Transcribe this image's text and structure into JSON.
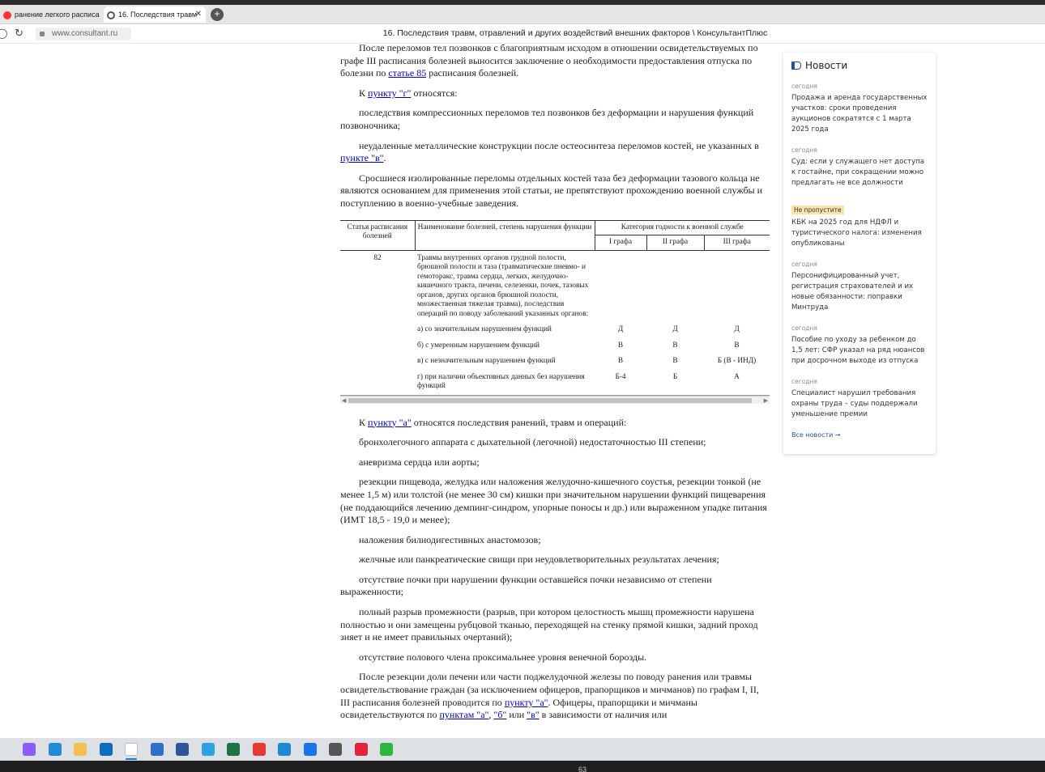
{
  "browser": {
    "tabs": [
      {
        "label": "ранение легкого расписа"
      },
      {
        "label": "16. Последствия травм"
      }
    ],
    "new_tab": "+",
    "url": "www.consultant.ru",
    "page_title": "16. Последствия травм, отравлений и других воздействий внешних факторов \\ КонсультантПлюс"
  },
  "doc": {
    "p0": "После переломов тел позвонков с благоприятным исходом в отношении освидетельствуемых по графе III расписания болезней выносится заключение о необходимости предоставления отпуска по болезни по ",
    "p0_link": "статье 85",
    "p0_tail": " расписания болезней.",
    "p1_pre": "К ",
    "p1_link": "пункту \"г\"",
    "p1_tail": " относятся:",
    "p2": "последствия компрессионных переломов тел позвонков без деформации и нарушения функций позвоночника;",
    "p3_pre": "неудаленные металлические конструкции после остеосинтеза переломов костей, не указанных в ",
    "p3_link": "пункте \"в\"",
    "p3_tail": ".",
    "p4": "Сросшиеся изолированные переломы отдельных костей таза без деформации тазового кольца не являются основанием для применения этой статьи, не препятствуют прохождению военной службы и поступлению в военно-учебные заведения.",
    "table": {
      "h_article": "Статья расписания болезней",
      "h_name": "Наименование болезней, степень нарушения функции",
      "h_category": "Категория годности к военной службе",
      "h_g1": "I графа",
      "h_g2": "II графа",
      "h_g3": "III графа",
      "article": "82",
      "desc": "Травмы внутренних органов грудной полости, брюшной полости и таза (травматические пневмо- и гемоторакс, травма сердца, легких, желудочно-кишечного тракта, печени, селезенки, почек, тазовых органов, других органов брюшной полости, множественная тяжелая травма), последствия операций по поводу заболеваний указанных органов:",
      "rows": [
        {
          "label": "а) со значительным нарушением функций",
          "g1": "Д",
          "g2": "Д",
          "g3": "Д"
        },
        {
          "label": "б) с умеренным нарушением функций",
          "g1": "В",
          "g2": "В",
          "g3": "В"
        },
        {
          "label": "в) с незначительным нарушением функций",
          "g1": "В",
          "g2": "В",
          "g3": "Б (В - ИНД)"
        },
        {
          "label": "г) при наличии объективных данных без нарушения функций",
          "g1": "Б-4",
          "g2": "Б",
          "g3": "А"
        }
      ]
    },
    "p5_pre": "К ",
    "p5_link": "пункту \"а\"",
    "p5_tail": " относятся последствия ранений, травм и операций:",
    "p6": "бронхолегочного аппарата с дыхательной (легочной) недостаточностью III степени;",
    "p7": "аневризма сердца или аорты;",
    "p8": "резекции пищевода, желудка или наложения желудочно-кишечного соустья, резекции тонкой (не менее 1,5 м) или толстой (не менее 30 см) кишки при значительном нарушении функций пищеварения (не поддающийся лечению демпинг-синдром, упорные поносы и др.) или выраженном упадке питания (ИМТ 18,5 - 19,0 и менее);",
    "p9": "наложения билиодигестивных анастомозов;",
    "p10": "желчные или панкреатические свищи при неудовлетворительных результатах лечения;",
    "p11": "отсутствие почки при нарушении функции оставшейся почки независимо от степени выраженности;",
    "p12": "полный разрыв промежности (разрыв, при котором целостность мышц промежности нарушена полностью и они замещены рубцовой тканью, переходящей на стенку прямой кишки, задний проход зияет и не имеет правильных очертаний);",
    "p13": "отсутствие полового члена проксимальнее уровня венечной борозды.",
    "p14_a": "После резекции доли печени или части поджелудочной железы по поводу ранения или травмы освидетельствование граждан (за исключением офицеров, прапорщиков и мичманов) по графам I, II, III расписания болезней проводится по ",
    "p14_link1": "пункту \"а\"",
    "p14_b": ". Офицеры, прапорщики и мичманы освидетельствуются по ",
    "p14_link2": "пунктам \"а\"",
    "p14_c": ", ",
    "p14_link3": "\"б\"",
    "p14_d": " или ",
    "p14_link4": "\"в\"",
    "p14_e": " в зависимости от наличия или"
  },
  "news": {
    "title": "Новости",
    "items": [
      {
        "date": "сегодня",
        "text": "Продажа и аренда государственных участков: сроки проведения аукционов сократятся с 1 марта 2025 года"
      },
      {
        "date": "сегодня",
        "text": "Суд: если у служащего нет доступа к гостайне, при сокращении можно предлагать не все должности"
      },
      {
        "badge": "Не пропустите",
        "text": "КБК на 2025 год для НДФЛ и туристического налога: изменения опубликованы"
      },
      {
        "date": "сегодня",
        "text": "Персонифицированный учет, регистрация страхователей и их новые обязанности: поправки Минтруда"
      },
      {
        "date": "сегодня",
        "text": "Пособие по уходу за ребенком до 1,5 лет: СФР указал на ряд нюансов при досрочном выходе из отпуска"
      },
      {
        "date": "сегодня",
        "text": "Специалист нарушил требования охраны труда – суды поддержали уменьшение премии"
      }
    ],
    "all_link": "Все новости →"
  },
  "taskbar": {
    "icons": [
      {
        "name": "alice-icon",
        "color": "#8b5cf6"
      },
      {
        "name": "edge-icon",
        "color": "#1f8ad6"
      },
      {
        "name": "file-explorer-icon",
        "color": "#f2c14e"
      },
      {
        "name": "outlook-icon",
        "color": "#0f6cbd"
      },
      {
        "name": "yandex-browser-icon",
        "color": "#ffffff"
      },
      {
        "name": "photos-icon",
        "color": "#2f6fc4"
      },
      {
        "name": "word-icon",
        "color": "#2b579a"
      },
      {
        "name": "telegram-icon",
        "color": "#2aa3df"
      },
      {
        "name": "excel-icon",
        "color": "#217346"
      },
      {
        "name": "yandex-icon",
        "color": "#e53935"
      },
      {
        "name": "mail-app-icon",
        "color": "#1b8ad3"
      },
      {
        "name": "mail-at-icon",
        "color": "#1a73e8"
      },
      {
        "name": "settings-gear-icon",
        "color": "#555555"
      },
      {
        "name": "opera-icon",
        "color": "#e0243a"
      },
      {
        "name": "whatsapp-icon",
        "color": "#2db742"
      }
    ],
    "bottom_num": "63"
  }
}
